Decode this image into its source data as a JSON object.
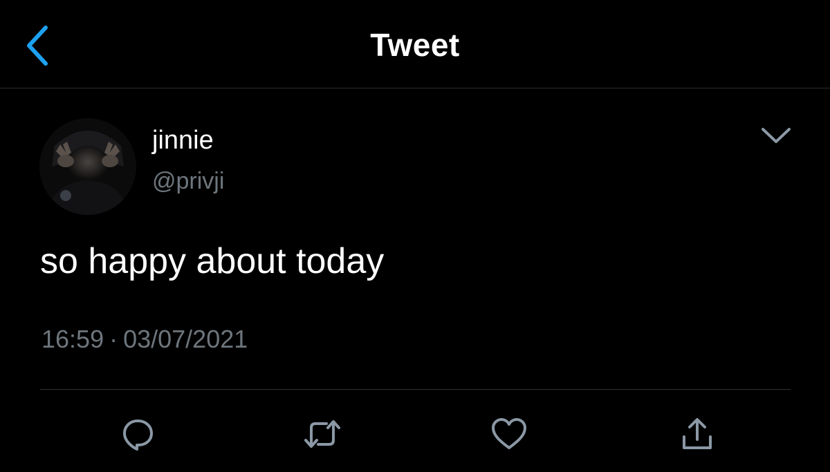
{
  "nav": {
    "title": "Tweet",
    "back_icon": "chevron-left-icon",
    "accent_color": "#1da1f2"
  },
  "tweet": {
    "author": {
      "display_name": "jinnie",
      "handle": "@privji"
    },
    "text": "so happy about today",
    "time": "16:59",
    "separator": "·",
    "date": "03/07/2021",
    "menu_icon": "chevron-down-icon"
  },
  "actions": [
    {
      "name": "reply",
      "icon": "reply-bubble-icon"
    },
    {
      "name": "retweet",
      "icon": "retweet-icon"
    },
    {
      "name": "like",
      "icon": "heart-icon"
    },
    {
      "name": "share",
      "icon": "share-icon"
    }
  ],
  "colors": {
    "background": "#000000",
    "primary_text": "#ffffff",
    "secondary_text": "#6e767d",
    "icon_gray": "#8b98a5",
    "divider": "#2f3336"
  }
}
